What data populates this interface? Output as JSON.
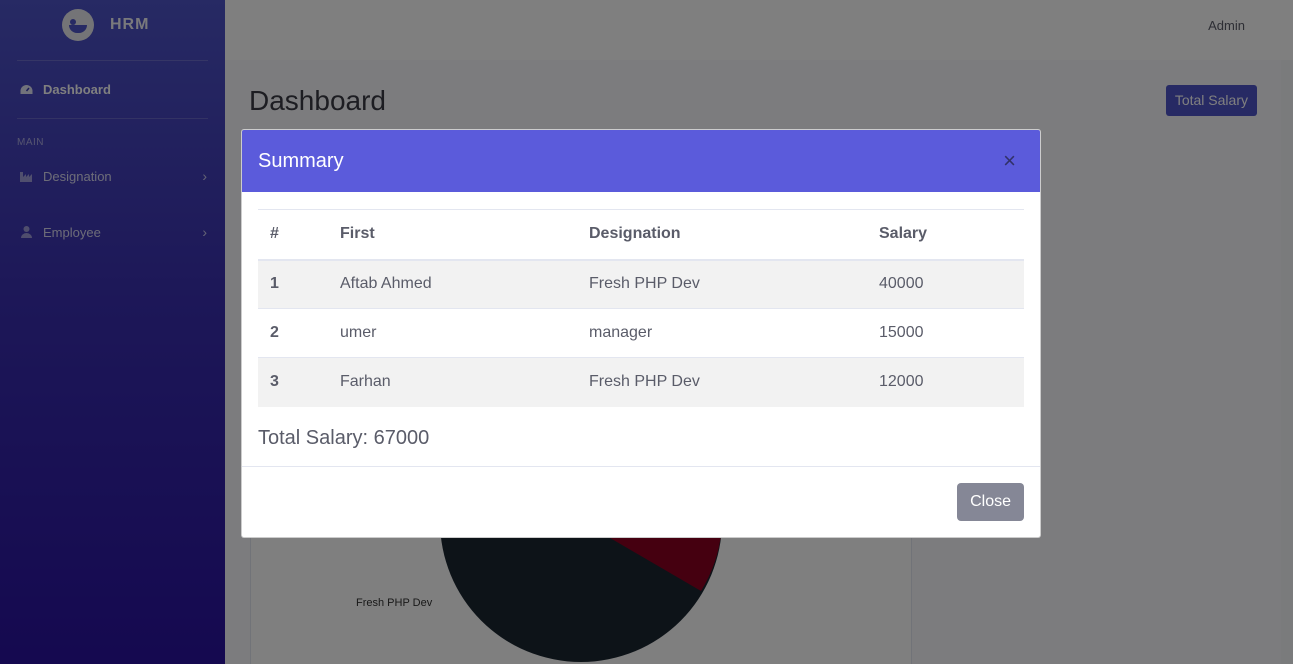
{
  "brand": {
    "name": "HRM"
  },
  "topbar": {
    "user": "Admin"
  },
  "sidebar": {
    "items": [
      {
        "label": "Dashboard",
        "icon": "tachometer-icon"
      },
      {
        "label": "Designation",
        "icon": "industry-icon"
      },
      {
        "label": "Employee",
        "icon": "user-icon"
      }
    ],
    "heading": "MAIN"
  },
  "page": {
    "title": "Dashboard",
    "total_salary_button": "Total Salary"
  },
  "chart": {
    "slice_label": "Fresh PHP Dev"
  },
  "modal": {
    "title": "Summary",
    "close_x": "×",
    "columns": [
      "#",
      "First",
      "Designation",
      "Salary"
    ],
    "rows": [
      [
        "1",
        "Aftab Ahmed",
        "Fresh PHP Dev",
        "40000"
      ],
      [
        "2",
        "umer",
        "manager",
        "15000"
      ],
      [
        "3",
        "Farhan",
        "Fresh PHP Dev",
        "12000"
      ]
    ],
    "total": "Total Salary: 67000",
    "close_button": "Close"
  },
  "colors": {
    "accent": "#4e54c8",
    "modal_header": "#5b5bdb",
    "pie_dark": "#1b2631",
    "pie_red": "#8b0020"
  }
}
